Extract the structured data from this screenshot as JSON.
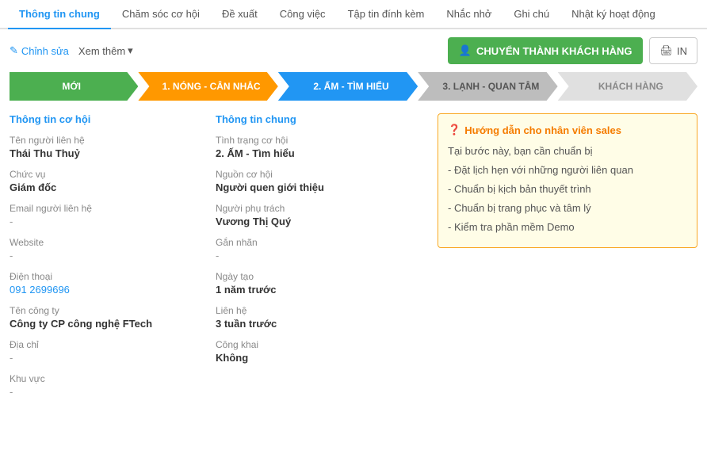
{
  "tabs": [
    {
      "id": "thong-tin-chung",
      "label": "Thông tin chung",
      "active": true
    },
    {
      "id": "cham-soc-co-hoi",
      "label": "Chăm sóc cơ hội",
      "active": false
    },
    {
      "id": "de-xuat",
      "label": "Đề xuất",
      "active": false
    },
    {
      "id": "cong-viec",
      "label": "Công việc",
      "active": false
    },
    {
      "id": "tap-tin-dinh-kem",
      "label": "Tập tin đính kèm",
      "active": false
    },
    {
      "id": "nhac-nho",
      "label": "Nhắc nhở",
      "active": false
    },
    {
      "id": "ghi-chu",
      "label": "Ghi chú",
      "active": false
    },
    {
      "id": "nhat-ky-hoat-dong",
      "label": "Nhật ký hoạt động",
      "active": false
    }
  ],
  "toolbar": {
    "edit_label": "Chỉnh sửa",
    "view_more_label": "Xem thêm",
    "convert_label": "CHUYỂN THÀNH KHÁCH HÀNG",
    "print_label": "IN"
  },
  "pipeline": [
    {
      "id": "moi",
      "label": "MỚI",
      "style": "green"
    },
    {
      "id": "nong",
      "label": "1. NÓNG - CÂN NHẮC",
      "style": "orange"
    },
    {
      "id": "am",
      "label": "2. ẤM - TÌM HIỂU",
      "style": "blue"
    },
    {
      "id": "lanh",
      "label": "3. LẠNH - QUAN TÂM",
      "style": "gray"
    },
    {
      "id": "khach-hang",
      "label": "KHÁCH HÀNG",
      "style": "light"
    }
  ],
  "left_panel": {
    "title": "Thông tin cơ hội",
    "fields": [
      {
        "label": "Tên người liên hệ",
        "value": "Thái Thu Thuỷ",
        "type": "bold"
      },
      {
        "label": "Chức vụ",
        "value": "Giám đốc",
        "type": "bold"
      },
      {
        "label": "Email người liên hệ",
        "value": "-",
        "type": "dash"
      },
      {
        "label": "Website",
        "value": "-",
        "type": "dash"
      },
      {
        "label": "Điện thoại",
        "value": "091 2699696",
        "type": "link"
      },
      {
        "label": "Tên công ty",
        "value": "Công ty CP công nghệ FTech",
        "type": "bold"
      },
      {
        "label": "Địa chỉ",
        "value": "-",
        "type": "dash"
      },
      {
        "label": "Khu vực",
        "value": "-",
        "type": "dash"
      }
    ]
  },
  "center_panel": {
    "title": "Thông tin chung",
    "fields": [
      {
        "label": "Tình trạng cơ hội",
        "value": "2. ẤM - Tìm hiểu",
        "type": "bold"
      },
      {
        "label": "Nguồn cơ hội",
        "value": "Người quen giới thiệu",
        "type": "bold"
      },
      {
        "label": "Người phụ trách",
        "value": "Vương Thị Quý",
        "type": "bold"
      },
      {
        "label": "Gắn nhãn",
        "value": "-",
        "type": "dash"
      },
      {
        "label": "Ngày tạo",
        "value": "1 năm trước",
        "type": "bold"
      },
      {
        "label": "Liên hệ",
        "value": "3 tuần trước",
        "type": "bold"
      },
      {
        "label": "Công khai",
        "value": "Không",
        "type": "bold"
      }
    ]
  },
  "right_panel": {
    "guide": {
      "title": "Hướng dẫn cho nhân viên sales",
      "icon": "❓",
      "intro": "Tại bước này, bạn cần chuẩn bị",
      "items": [
        "- Đặt lịch hẹn với những người liên quan",
        "- Chuẩn bị kịch bản thuyết trình",
        "- Chuẩn bị trang phục và tâm lý",
        "- Kiểm tra phần mềm Demo"
      ]
    }
  }
}
